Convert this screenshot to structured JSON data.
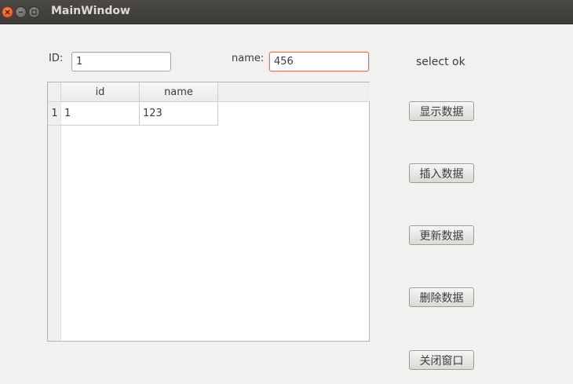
{
  "window": {
    "title": "MainWindow",
    "controls": {
      "close_icon": "close-icon",
      "minimize_icon": "minimize-icon",
      "maximize_icon": "maximize-icon"
    }
  },
  "form": {
    "id_label": "ID:",
    "id_value": "1",
    "name_label": "name:",
    "name_value": "456"
  },
  "status": "select ok",
  "table": {
    "columns": [
      "id",
      "name"
    ],
    "rows": [
      {
        "row_number": "1",
        "cells": [
          "1",
          "123"
        ]
      }
    ]
  },
  "buttons": {
    "show": "显示数据",
    "insert": "插入数据",
    "update": "更新数据",
    "delete": "删除数据",
    "close": "关闭窗口"
  },
  "colors": {
    "titlebar": "#3c3b37",
    "close_button": "#df4a16",
    "focus_border": "#e07a4d",
    "background": "#f2f1f0"
  }
}
